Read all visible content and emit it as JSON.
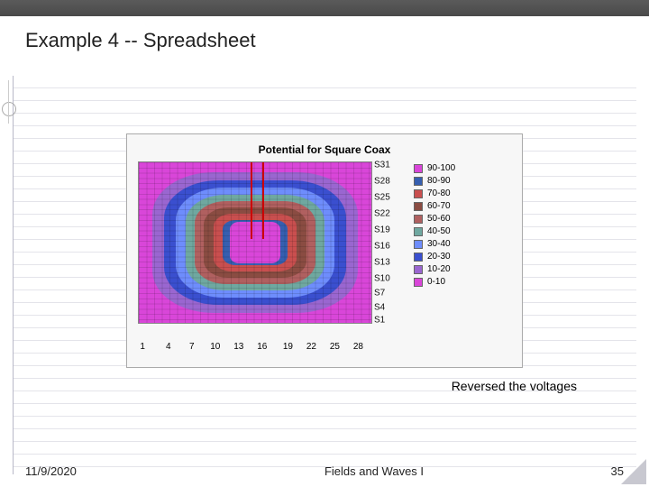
{
  "slide": {
    "title": "Example 4 -- Spreadsheet",
    "note": "Reversed the voltages"
  },
  "footer": {
    "date": "11/9/2020",
    "center": "Fields and Waves I",
    "page": "35"
  },
  "chart_data": {
    "type": "heatmap",
    "title": "Potential for Square Coax",
    "xlabel": "",
    "ylabel": "",
    "x_ticks": [
      "1",
      "4",
      "7",
      "10",
      "13",
      "16",
      "19",
      "22",
      "25",
      "28"
    ],
    "y_ticks": [
      "S1",
      "S4",
      "S7",
      "S10",
      "S13",
      "S16",
      "S19",
      "S22",
      "S25",
      "S28",
      "S31"
    ],
    "grid_size": [
      31,
      31
    ],
    "legend_bins": [
      {
        "label": "90-100",
        "range": [
          90,
          100
        ],
        "color": "#d946d9"
      },
      {
        "label": "80-90",
        "range": [
          80,
          90
        ],
        "color": "#365fb0"
      },
      {
        "label": "70-80",
        "range": [
          70,
          80
        ],
        "color": "#c94f4f"
      },
      {
        "label": "60-70",
        "range": [
          60,
          70
        ],
        "color": "#8a4c42"
      },
      {
        "label": "50-60",
        "range": [
          50,
          60
        ],
        "color": "#b06060"
      },
      {
        "label": "40-50",
        "range": [
          40,
          50
        ],
        "color": "#6fa8a0"
      },
      {
        "label": "30-40",
        "range": [
          30,
          40
        ],
        "color": "#6e8dfc"
      },
      {
        "label": "20-30",
        "range": [
          20,
          30
        ],
        "color": "#3a4fcf"
      },
      {
        "label": "10-20",
        "range": [
          10,
          20
        ],
        "color": "#9a66d0"
      },
      {
        "label": "0-10",
        "range": [
          0,
          10
        ],
        "color": "#d946d9"
      }
    ],
    "contour_levels": [
      0,
      10,
      20,
      30,
      40,
      50,
      60,
      70,
      80,
      90,
      100
    ],
    "description": "Concentric square contour plot. Outer boundary at potential 0, inner square conductor at potential 100; potential increases monotonically from outer edge toward center in roughly uniform 10-unit bands."
  }
}
